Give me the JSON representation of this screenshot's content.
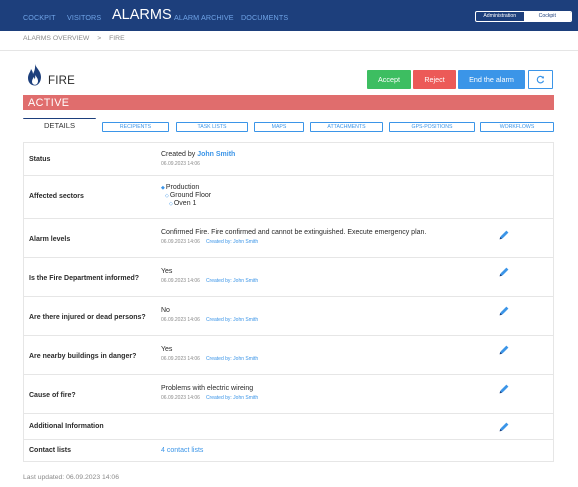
{
  "nav": {
    "items": [
      "COCKPIT",
      "VISITORS",
      "ALARMS",
      "ALARM ARCHIVE",
      "DOCUMENTS"
    ],
    "active": "ALARMS",
    "mode_toggle": [
      "Administration",
      "Cockpit"
    ],
    "mode_selected": "Cockpit"
  },
  "breadcrumb": [
    "ALARMS OVERVIEW",
    ">",
    "FIRE"
  ],
  "alarm": {
    "title": "FIRE",
    "status": "ACTIVE",
    "icon": "flame-icon"
  },
  "actions": {
    "accept": "Accept",
    "reject": "Reject",
    "end": "End the alarm",
    "refresh_icon": "refresh-icon"
  },
  "tabs": [
    "DETAILS",
    "RECIPIENTS",
    "TASK LISTS",
    "MAPS",
    "ATTACHMENTS",
    "GPS-POSITIONS",
    "WORKFLOWS"
  ],
  "details": {
    "status": {
      "label": "Status",
      "created_by_prefix": "Created by",
      "created_by": "John Smith",
      "date": "06.09.2023 14:06"
    },
    "sectors": {
      "label": "Affected sectors",
      "items": [
        "Production",
        "Ground Floor",
        "Oven 1"
      ]
    },
    "alarm_levels": {
      "label": "Alarm levels",
      "value": "Confirmed Fire. Fire confirmed and cannot be extinguished. Execute emergency plan.",
      "date": "06.09.2023 14:06",
      "by": "Created by: John Smith"
    },
    "fire_dept": {
      "label": "Is the Fire Department informed?",
      "value": "Yes",
      "date": "06.09.2023 14:06",
      "by": "Created by: John Smith"
    },
    "injured": {
      "label": "Are there injured or dead persons?",
      "value": "No",
      "date": "06.09.2023 14:06",
      "by": "Created by: John Smith"
    },
    "buildings": {
      "label": "Are nearby buildings in danger?",
      "value": "Yes",
      "date": "06.09.2023 14:06",
      "by": "Created by: John Smith"
    },
    "cause": {
      "label": "Cause of fire?",
      "value": "Problems with electric wireing",
      "date": "06.09.2023 14:06",
      "by": "Created by: John Smith"
    },
    "additional": {
      "label": "Additional Information"
    },
    "contacts": {
      "label": "Contact lists",
      "value": "4 contact lists"
    }
  },
  "footer": {
    "last_updated": "Last updated: 06.09.2023 14:06"
  },
  "colors": {
    "nav_bg": "#1d3f7c",
    "accent": "#3b95e8",
    "accept": "#3dbe61",
    "reject": "#ec5a58",
    "status_active": "#e06d6d"
  }
}
